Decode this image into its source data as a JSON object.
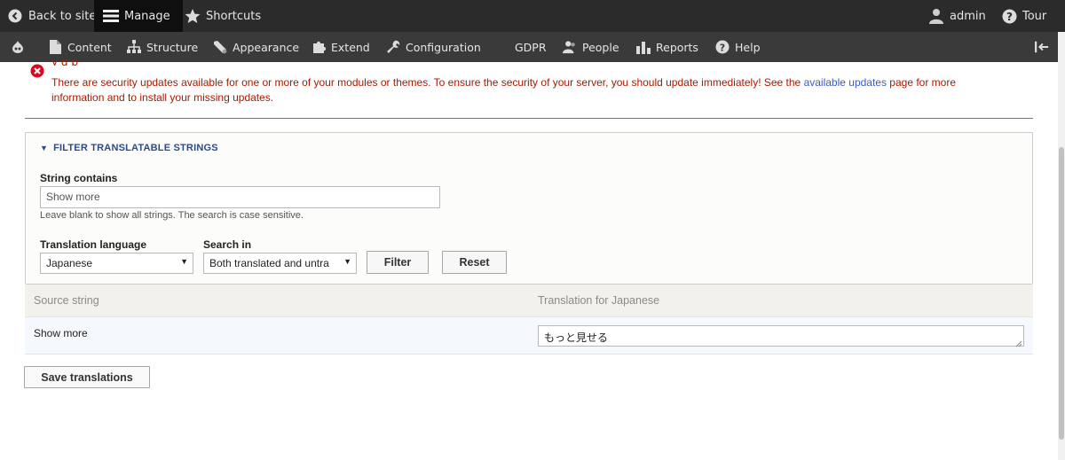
{
  "toolbar": {
    "back_to_site": "Back to site",
    "manage": "Manage",
    "shortcuts": "Shortcuts",
    "admin": "admin",
    "tour": "Tour"
  },
  "tray": {
    "items": [
      "Content",
      "Structure",
      "Appearance",
      "Extend",
      "Configuration",
      "GDPR",
      "People",
      "Reports",
      "Help"
    ]
  },
  "messages": {
    "error_partial": "y              g  p",
    "error_text_before": "There are security updates available for one or more of your modules or themes. To ensure the security of your server, you should update immediately! See the ",
    "error_link": "available updates",
    "error_text_after": " page for more information and to install your missing updates."
  },
  "filter": {
    "title": "FILTER TRANSLATABLE STRINGS",
    "string_contains_label": "String contains",
    "string_contains_value": "Show more",
    "help_text": "Leave blank to show all strings. The search is case sensitive.",
    "language_label": "Translation language",
    "language_value": "Japanese",
    "search_in_label": "Search in",
    "search_in_value": "Both translated and untra",
    "filter_button": "Filter",
    "reset_button": "Reset"
  },
  "table": {
    "headers": [
      "Source string",
      "Translation for Japanese"
    ],
    "rows": [
      {
        "source": "Show more",
        "translation": "もっと見せる"
      }
    ]
  },
  "save_button": "Save translations",
  "colors": {
    "toolbar_bg": "#2b2b2b",
    "tray_bg": "#3a3a3a",
    "error_text": "#a51b00",
    "link": "#3b5bc4",
    "filter_title": "#2b4a8a"
  }
}
